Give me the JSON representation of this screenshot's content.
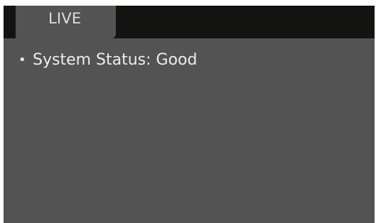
{
  "tabs": [
    {
      "label": "LIVE",
      "active": true
    }
  ],
  "status": {
    "bullet": "•",
    "label": "System Status:",
    "value": "Good"
  },
  "colors": {
    "panel": "#535354",
    "tabbar": "#131311",
    "text": "#ececec"
  }
}
